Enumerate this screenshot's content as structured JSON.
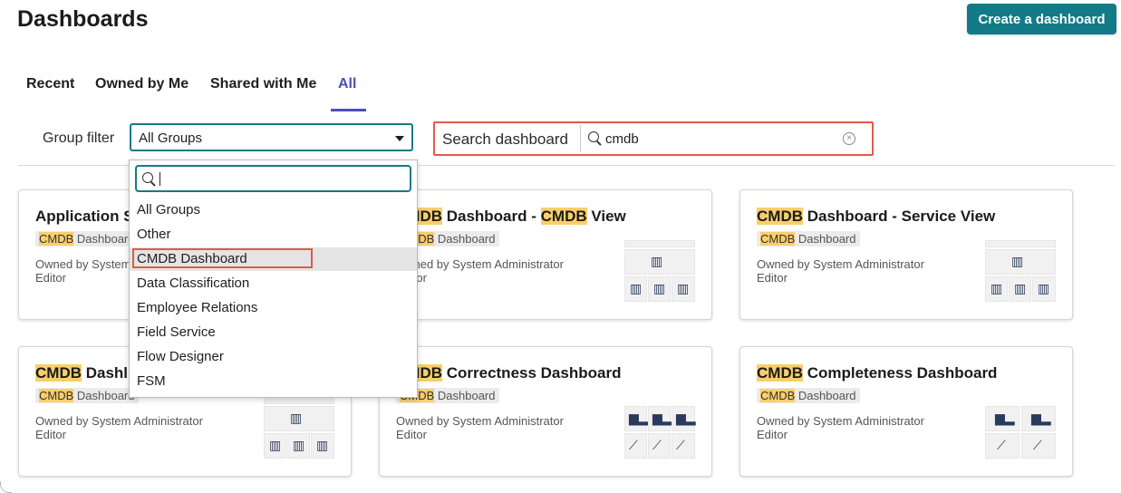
{
  "header": {
    "title": "Dashboards",
    "create_button": "Create a dashboard"
  },
  "tabs": [
    {
      "label": "Recent"
    },
    {
      "label": "Owned by Me"
    },
    {
      "label": "Shared with Me"
    },
    {
      "label": "All",
      "active": true
    }
  ],
  "filters": {
    "group_label": "Group filter",
    "group_value": "All Groups",
    "search_label": "Search dashboard",
    "search_value": "cmdb"
  },
  "dropdown": {
    "search_value": "",
    "options": [
      "All Groups",
      "Other",
      "CMDB Dashboard",
      "Data Classification",
      "Employee Relations",
      "Field Service",
      "Flow Designer",
      "FSM"
    ],
    "highlighted": "CMDB Dashboard"
  },
  "cards": [
    {
      "title_hl": "",
      "title_rest": "Application S",
      "tag_hl": "CMDB",
      "tag_rest": " Dashboard",
      "owner": "Owned by System Administrator",
      "role": "Editor",
      "thumb": "grid"
    },
    {
      "title_hl": "CMDB",
      "title_pre": "",
      "title_mid": " Dashboard - ",
      "title_hl2": "CMDB",
      "title_end": " View",
      "tag_hl": "CMDB",
      "tag_rest": " Dashboard",
      "owner": "Owned by System Administrator",
      "role": "Editor",
      "thumb": "grid"
    },
    {
      "title_hl": "CMDB",
      "title_rest": " Dashboard - Service View",
      "tag_hl": "CMDB",
      "tag_rest": " Dashboard",
      "owner": "Owned by System Administrator",
      "role": "Editor",
      "thumb": "grid"
    },
    {
      "title_hl": "CMDB",
      "title_rest": " Dashl",
      "tag_hl": "CMDB",
      "tag_rest": " Dashboard",
      "owner": "Owned by System Administrator",
      "role": "Editor",
      "thumb": "grid"
    },
    {
      "title_hl": "CMDB",
      "title_rest": " Correctness Dashboard",
      "tag_hl": "CMDB",
      "tag_rest": " Dashboard",
      "owner": "Owned by System Administrator",
      "role": "Editor",
      "thumb": "bars-lines"
    },
    {
      "title_hl": "CMDB",
      "title_rest": " Completeness Dashboard",
      "tag_hl": "CMDB",
      "tag_rest": " Dashboard",
      "owner": "Owned by System Administrator",
      "role": "Editor",
      "thumb": "bars-lines-2"
    }
  ],
  "icons": {
    "search": "search-icon",
    "clear": "clear-icon",
    "caret": "chevron-down-icon",
    "widget": "widget-grid-icon",
    "bar": "bar-chart-icon",
    "line": "line-chart-icon"
  },
  "colors": {
    "accent": "#127b87",
    "tab_active": "#4a4fb8",
    "highlight": "#f9cf6a",
    "outline": "#e05a4e"
  }
}
